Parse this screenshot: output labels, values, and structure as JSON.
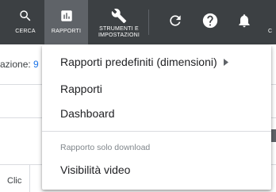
{
  "toolbar": {
    "search_label": "CERCA",
    "reports_label": "RAPPORTI",
    "tools_label_line1": "STRUMENTI E",
    "tools_label_line2": "IMPOSTAZIONI",
    "edge_label": "C"
  },
  "icons": {
    "search": "search-icon",
    "reports": "bar-chart-icon",
    "tools": "wrench-icon",
    "refresh": "refresh-icon",
    "help": "help-icon",
    "notifications": "bell-icon"
  },
  "page": {
    "partial_label": "azione: ",
    "partial_value": "9",
    "column_header": "Clic"
  },
  "menu": {
    "items": [
      {
        "label": "Rapporti predefiniti (dimensioni)",
        "has_submenu": true
      },
      {
        "label": "Rapporti"
      },
      {
        "label": "Dashboard"
      }
    ],
    "section_header": "Rapporto solo download",
    "section_items": [
      {
        "label": "Visibilità video"
      }
    ]
  },
  "colors": {
    "toolbar_bg": "#3c4043",
    "active_tab_bg": "#5f6368",
    "link_blue": "#1a73e8"
  }
}
